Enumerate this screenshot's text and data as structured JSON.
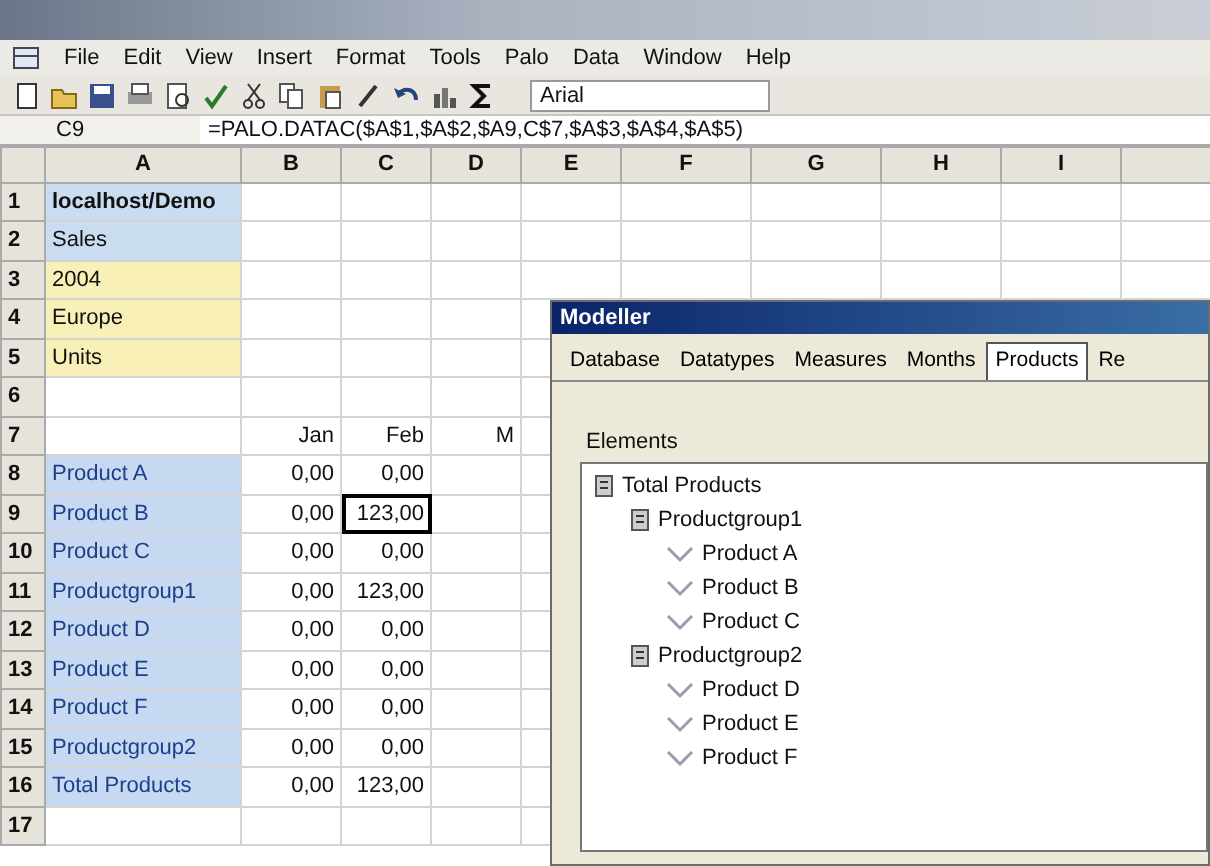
{
  "menu": [
    "File",
    "Edit",
    "View",
    "Insert",
    "Format",
    "Tools",
    "Palo",
    "Data",
    "Window",
    "Help"
  ],
  "toolbar": {
    "font": "Arial"
  },
  "formula_bar": {
    "name_box": "C9",
    "formula": "=PALO.DATAC($A$1,$A$2,$A9,C$7,$A$3,$A$4,$A$5)"
  },
  "columns": [
    "A",
    "B",
    "C",
    "D",
    "E",
    "F",
    "G",
    "H",
    "I"
  ],
  "rows": [
    {
      "number": "1",
      "kind": "title",
      "label": "localhost/Demo"
    },
    {
      "number": "2",
      "kind": "cube",
      "label": "Sales"
    },
    {
      "number": "3",
      "kind": "dimension",
      "label": "2004"
    },
    {
      "number": "4",
      "kind": "dimension",
      "label": "Europe"
    },
    {
      "number": "5",
      "kind": "dimension",
      "label": "Units"
    },
    {
      "number": "6"
    },
    {
      "number": "7",
      "values": [
        {
          "text": "Jan",
          "selected": false
        },
        {
          "text": "Feb",
          "selected": false
        },
        {
          "text": "M",
          "selected": false
        }
      ]
    },
    {
      "number": "8",
      "kind": "element",
      "label": "Product A",
      "values": [
        {
          "text": "0,00",
          "selected": false
        },
        {
          "text": "0,00",
          "selected": false
        }
      ]
    },
    {
      "number": "9",
      "kind": "element",
      "label": "Product B",
      "values": [
        {
          "text": "0,00",
          "selected": false
        },
        {
          "text": "123,00",
          "selected": true
        }
      ]
    },
    {
      "number": "10",
      "kind": "element",
      "label": "Product C",
      "values": [
        {
          "text": "0,00",
          "selected": false
        },
        {
          "text": "0,00",
          "selected": false
        }
      ]
    },
    {
      "number": "11",
      "kind": "element",
      "label": "Productgroup1",
      "values": [
        {
          "text": "0,00",
          "selected": false
        },
        {
          "text": "123,00",
          "selected": false
        }
      ]
    },
    {
      "number": "12",
      "kind": "element",
      "label": "Product D",
      "values": [
        {
          "text": "0,00",
          "selected": false
        },
        {
          "text": "0,00",
          "selected": false
        }
      ]
    },
    {
      "number": "13",
      "kind": "element",
      "label": "Product E",
      "values": [
        {
          "text": "0,00",
          "selected": false
        },
        {
          "text": "0,00",
          "selected": false
        }
      ]
    },
    {
      "number": "14",
      "kind": "element",
      "label": "Product F",
      "values": [
        {
          "text": "0,00",
          "selected": false
        },
        {
          "text": "0,00",
          "selected": false
        }
      ]
    },
    {
      "number": "15",
      "kind": "element",
      "label": "Productgroup2",
      "values": [
        {
          "text": "0,00",
          "selected": false
        },
        {
          "text": "0,00",
          "selected": false
        }
      ]
    },
    {
      "number": "16",
      "kind": "element",
      "label": "Total Products",
      "values": [
        {
          "text": "0,00",
          "selected": false
        },
        {
          "text": "123,00",
          "selected": false
        }
      ]
    },
    {
      "number": "17"
    }
  ],
  "dialog": {
    "title": "Modeller",
    "tabs": [
      {
        "label": "Database",
        "selected": false
      },
      {
        "label": "Datatypes",
        "selected": false
      },
      {
        "label": "Measures",
        "selected": false
      },
      {
        "label": "Months",
        "selected": false
      },
      {
        "label": "Products",
        "selected": true
      },
      {
        "label": "Re",
        "selected": false
      }
    ],
    "elements_label": "Elements",
    "tree": [
      {
        "label": "Total Products",
        "children": [
          {
            "label": "Productgroup1",
            "children": [
              {
                "label": "Product A"
              },
              {
                "label": "Product B"
              },
              {
                "label": "Product C"
              }
            ]
          },
          {
            "label": "Productgroup2",
            "children": [
              {
                "label": "Product D"
              },
              {
                "label": "Product E"
              },
              {
                "label": "Product F"
              }
            ]
          }
        ]
      }
    ]
  }
}
